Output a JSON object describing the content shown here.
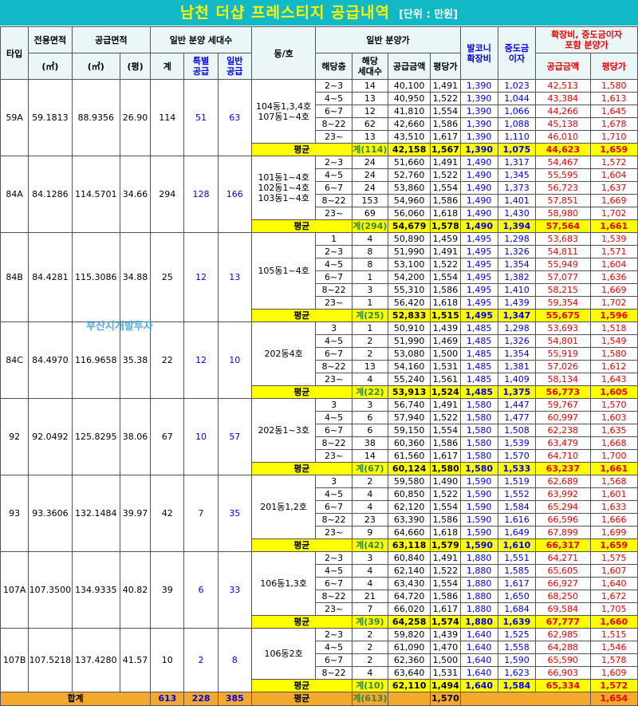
{
  "title": "남천 더샵 프레스티지 공급내역",
  "unit": "[단위 : 만원]",
  "watermark": "부산지개발투자",
  "headers": {
    "type": "타입",
    "exclusive_area": "전용면적",
    "supply_area": "공급면적",
    "general_units": "일반 분양 세대수",
    "dong_ho": "동/호",
    "general_price": "일반 분양가",
    "balcony": "발코니\n확장비",
    "interest": "중도금\n이자",
    "incl": "확장비, 중도금이자\n포함 분양가",
    "m2": "(㎡)",
    "pyeong": "(평)",
    "total": "계",
    "special": "특별\n공급",
    "general": "일반\n공급",
    "floor": "해당층",
    "floor_units": "해당\n세대수",
    "supply_amount": "공급금액",
    "per_pyeong": "평당가",
    "incl_amount": "공급금액",
    "incl_per_pyeong": "평당가"
  },
  "avg_label": "평균",
  "types": [
    {
      "type": "59A",
      "exclusive": "59.1813",
      "supply_m2": "88.9356",
      "supply_py": "26.90",
      "total": "114",
      "special": "51",
      "general": "63",
      "dongho": "104동1,3,4호\n107동1~4호",
      "rows": [
        [
          "2~3",
          "14",
          "40,100",
          "1,491",
          "1,390",
          "1,023",
          "42,513",
          "1,580"
        ],
        [
          "4~5",
          "13",
          "40,950",
          "1,522",
          "1,390",
          "1,044",
          "43,384",
          "1,613"
        ],
        [
          "6~7",
          "12",
          "41,810",
          "1,554",
          "1,390",
          "1,066",
          "44,266",
          "1,645"
        ],
        [
          "8~22",
          "62",
          "42,660",
          "1,586",
          "1,390",
          "1,088",
          "45,138",
          "1,678"
        ],
        [
          "23~",
          "13",
          "43,510",
          "1,617",
          "1,390",
          "1,110",
          "46,010",
          "1,710"
        ]
      ],
      "avg": [
        "계(114)",
        "42,158",
        "1,567",
        "1,390",
        "1,075",
        "44,623",
        "1,659"
      ]
    },
    {
      "type": "84A",
      "exclusive": "84.1286",
      "supply_m2": "114.5701",
      "supply_py": "34.66",
      "total": "294",
      "special": "128",
      "general": "166",
      "dongho": "101동1~4호\n102동1~4호\n103동1~4호",
      "rows": [
        [
          "2~3",
          "24",
          "51,660",
          "1,491",
          "1,490",
          "1,317",
          "54,467",
          "1,572"
        ],
        [
          "4~5",
          "24",
          "52,760",
          "1,522",
          "1,490",
          "1,345",
          "55,595",
          "1,604"
        ],
        [
          "6~7",
          "24",
          "53,860",
          "1,554",
          "1,490",
          "1,373",
          "56,723",
          "1,637"
        ],
        [
          "8~22",
          "153",
          "54,960",
          "1,586",
          "1,490",
          "1,401",
          "57,851",
          "1,669"
        ],
        [
          "23~",
          "69",
          "56,060",
          "1,618",
          "1,490",
          "1,430",
          "58,980",
          "1,702"
        ]
      ],
      "avg": [
        "계(294)",
        "54,679",
        "1,578",
        "1,490",
        "1,394",
        "57,564",
        "1,661"
      ]
    },
    {
      "type": "84B",
      "exclusive": "84.4281",
      "supply_m2": "115.3086",
      "supply_py": "34.88",
      "total": "25",
      "special": "12",
      "general": "13",
      "dongho": "105동1~4호",
      "rows": [
        [
          "1",
          "4",
          "50,890",
          "1,459",
          "1,495",
          "1,298",
          "53,683",
          "1,539"
        ],
        [
          "2~3",
          "8",
          "51,990",
          "1,491",
          "1,495",
          "1,326",
          "54,811",
          "1,571"
        ],
        [
          "4~5",
          "8",
          "53,100",
          "1,522",
          "1,495",
          "1,354",
          "55,949",
          "1,604"
        ],
        [
          "6~7",
          "1",
          "54,200",
          "1,554",
          "1,495",
          "1,382",
          "57,077",
          "1,636"
        ],
        [
          "8~22",
          "3",
          "55,310",
          "1,586",
          "1,495",
          "1,410",
          "58,215",
          "1,669"
        ],
        [
          "23~",
          "1",
          "56,420",
          "1,618",
          "1,495",
          "1,439",
          "59,354",
          "1,702"
        ]
      ],
      "avg": [
        "계(25)",
        "52,833",
        "1,515",
        "1,495",
        "1,347",
        "55,675",
        "1,596"
      ]
    },
    {
      "type": "84C",
      "exclusive": "84.4970",
      "supply_m2": "116.9658",
      "supply_py": "35.38",
      "total": "22",
      "special": "12",
      "general": "10",
      "dongho": "202동4호",
      "rows": [
        [
          "3",
          "1",
          "50,910",
          "1,439",
          "1,485",
          "1,298",
          "53,693",
          "1,518"
        ],
        [
          "4~5",
          "2",
          "51,990",
          "1,469",
          "1,485",
          "1,326",
          "54,801",
          "1,549"
        ],
        [
          "6~7",
          "2",
          "53,080",
          "1,500",
          "1,485",
          "1,354",
          "55,919",
          "1,580"
        ],
        [
          "8~22",
          "13",
          "54,160",
          "1,531",
          "1,485",
          "1,381",
          "57,026",
          "1,612"
        ],
        [
          "23~",
          "4",
          "55,240",
          "1,561",
          "1,485",
          "1,409",
          "58,134",
          "1,643"
        ]
      ],
      "avg": [
        "계(22)",
        "53,913",
        "1,524",
        "1,485",
        "1,375",
        "56,773",
        "1,605"
      ]
    },
    {
      "type": "92",
      "exclusive": "92.0492",
      "supply_m2": "125.8295",
      "supply_py": "38.06",
      "total": "67",
      "special": "10",
      "general": "57",
      "dongho": "202동1~3호",
      "rows": [
        [
          "3",
          "3",
          "56,740",
          "1,491",
          "1,580",
          "1,447",
          "59,767",
          "1,570"
        ],
        [
          "4~5",
          "6",
          "57,940",
          "1,522",
          "1,580",
          "1,477",
          "60,997",
          "1,603"
        ],
        [
          "6~7",
          "6",
          "59,150",
          "1,554",
          "1,580",
          "1,508",
          "62,238",
          "1,635"
        ],
        [
          "8~22",
          "38",
          "60,360",
          "1,586",
          "1,580",
          "1,539",
          "63,479",
          "1,668"
        ],
        [
          "23~",
          "14",
          "61,560",
          "1,617",
          "1,580",
          "1,570",
          "64,710",
          "1,700"
        ]
      ],
      "avg": [
        "계(67)",
        "60,124",
        "1,580",
        "1,580",
        "1,533",
        "63,237",
        "1,661"
      ]
    },
    {
      "type": "93",
      "exclusive": "93.3606",
      "supply_m2": "132.1484",
      "supply_py": "39.97",
      "total": "42",
      "special": "7",
      "general": "35",
      "dongho": "201동1,2호",
      "rows": [
        [
          "3",
          "2",
          "59,580",
          "1,490",
          "1,590",
          "1,519",
          "62,689",
          "1,568"
        ],
        [
          "4~5",
          "4",
          "60,850",
          "1,522",
          "1,590",
          "1,552",
          "63,992",
          "1,601"
        ],
        [
          "6~7",
          "4",
          "62,120",
          "1,554",
          "1,590",
          "1,584",
          "65,294",
          "1,633"
        ],
        [
          "8~22",
          "23",
          "63,390",
          "1,586",
          "1,590",
          "1,616",
          "66,596",
          "1,666"
        ],
        [
          "23~",
          "9",
          "64,660",
          "1,618",
          "1,590",
          "1,649",
          "67,899",
          "1,699"
        ]
      ],
      "avg": [
        "계(42)",
        "63,118",
        "1,579",
        "1,590",
        "1,610",
        "66,317",
        "1,659"
      ]
    },
    {
      "type": "107A",
      "exclusive": "107.3500",
      "supply_m2": "134.9335",
      "supply_py": "40.82",
      "total": "39",
      "special": "6",
      "general": "33",
      "dongho": "106동1,3호",
      "rows": [
        [
          "2~3",
          "3",
          "60,840",
          "1,491",
          "1,880",
          "1,551",
          "64,271",
          "1,575"
        ],
        [
          "4~5",
          "4",
          "62,140",
          "1,522",
          "1,880",
          "1,585",
          "65,605",
          "1,607"
        ],
        [
          "6~7",
          "4",
          "63,430",
          "1,554",
          "1,880",
          "1,617",
          "66,927",
          "1,640"
        ],
        [
          "8~22",
          "21",
          "64,720",
          "1,586",
          "1,880",
          "1,650",
          "68,250",
          "1,672"
        ],
        [
          "23~",
          "7",
          "66,020",
          "1,617",
          "1,880",
          "1,684",
          "69,584",
          "1,705"
        ]
      ],
      "avg": [
        "계(39)",
        "64,258",
        "1,574",
        "1,880",
        "1,639",
        "67,777",
        "1,660"
      ]
    },
    {
      "type": "107B",
      "exclusive": "107.5218",
      "supply_m2": "137.4280",
      "supply_py": "41.57",
      "total": "10",
      "special": "2",
      "general": "8",
      "dongho": "106동2호",
      "rows": [
        [
          "2~3",
          "2",
          "59,820",
          "1,439",
          "1,640",
          "1,525",
          "62,985",
          "1,515"
        ],
        [
          "4~5",
          "2",
          "61,090",
          "1,470",
          "1,640",
          "1,558",
          "64,288",
          "1,546"
        ],
        [
          "6~7",
          "2",
          "62,360",
          "1,500",
          "1,640",
          "1,590",
          "65,590",
          "1,578"
        ],
        [
          "8~22",
          "4",
          "63,640",
          "1,531",
          "1,640",
          "1,623",
          "66,903",
          "1,609"
        ]
      ],
      "avg": [
        "계(10)",
        "62,110",
        "1,494",
        "1,640",
        "1,584",
        "65,334",
        "1,572"
      ]
    }
  ],
  "grand_total": {
    "label": "합계",
    "total": "613",
    "special": "228",
    "general": "385",
    "avg_label": "평균",
    "units": "계(613)",
    "per_pyeong": "1,570",
    "incl_per_pyeong": "1,654"
  }
}
